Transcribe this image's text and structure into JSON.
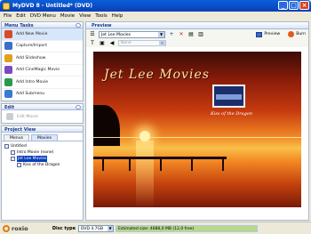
{
  "window": {
    "title": "MyDVD 8 - Untitled* (DVD)"
  },
  "menubar": [
    "File",
    "Edit",
    "DVD Menu",
    "Movie",
    "View",
    "Tools",
    "Help"
  ],
  "menu_tasks": {
    "title": "Menu Tasks",
    "items": [
      {
        "label": "Add New Movie",
        "icon": "add-movie-icon",
        "color": "#d64b2a"
      },
      {
        "label": "Capture/Import",
        "icon": "capture-icon",
        "color": "#3b6ec8"
      },
      {
        "label": "Add Slideshow",
        "icon": "slideshow-icon",
        "color": "#e0a020"
      },
      {
        "label": "Add CineMagic Movie",
        "icon": "cinemagic-icon",
        "color": "#7a4ac0"
      },
      {
        "label": "Add Intro Movie",
        "icon": "intro-icon",
        "color": "#2a9a4a"
      },
      {
        "label": "Add Submenu",
        "icon": "submenu-icon",
        "color": "#3a7ad0"
      }
    ]
  },
  "edit": {
    "title": "Edit",
    "item": "Edit Movie"
  },
  "project_view": {
    "title": "Project View",
    "tabs": [
      "Menus",
      "Movies"
    ],
    "tree": [
      {
        "label": "Untitled",
        "depth": 0
      },
      {
        "label": "Intro Movie (none)",
        "depth": 1
      },
      {
        "label": "Jet Lee Movies",
        "depth": 1,
        "selected": true
      },
      {
        "label": "Kiss of the Dragon",
        "depth": 2
      }
    ]
  },
  "preview": {
    "title": "Preview",
    "menu_select": "Jet Lee Movies",
    "preview_label": "Preview",
    "burn_label": "Burn",
    "font_select": "None",
    "menu_title": "Jet Lee Movies",
    "thumb_caption": "Kiss of the Dragon"
  },
  "status": {
    "logo": "roxio",
    "disc_label": "Disc type",
    "disc_value": "DVD 4.7GB",
    "estimate": "Estimated size: 4688,0 MB (12,0 free)",
    "usage_fraction": 0.997
  }
}
